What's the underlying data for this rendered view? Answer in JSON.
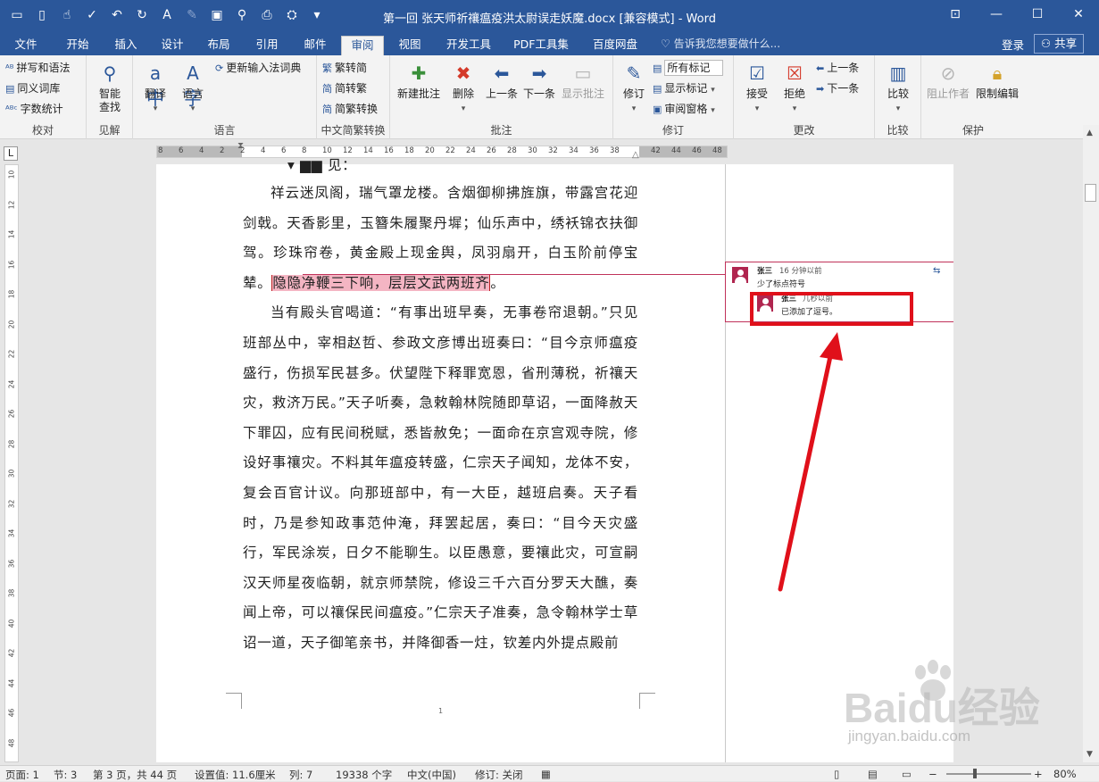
{
  "window": {
    "title": "第一回 张天师祈禳瘟疫洪太尉误走妖魔.docx [兼容模式] - Word",
    "qat": [
      "folder-icon",
      "new-doc-icon",
      "touch-icon",
      "spell-icon",
      "undo-icon",
      "redo-icon",
      "format-painter-icon",
      "print-preview-icon",
      "save-icon",
      "find-icon",
      "preview-icon",
      "share-icon",
      "customize-icon"
    ]
  },
  "tabs": [
    "文件",
    "开始",
    "插入",
    "设计",
    "布局",
    "引用",
    "邮件",
    "审阅",
    "视图",
    "开发工具",
    "PDF工具集",
    "百度网盘"
  ],
  "active_tab": "审阅",
  "tellme": "告诉我您想要做什么...",
  "account": {
    "login": "登录",
    "share": "共享"
  },
  "ribbon": {
    "proofing": {
      "label": "校对",
      "items": [
        "拼写和语法",
        "同义词库",
        "字数统计"
      ]
    },
    "insights": {
      "label": "见解",
      "smart_lookup": "智能\n查找",
      "smart_lookup_1": "智能",
      "smart_lookup_2": "查找"
    },
    "language": {
      "label": "语言",
      "translate": "翻译",
      "language": "语言",
      "ime": "更新输入法词典"
    },
    "chinese": {
      "label": "中文简繁转换",
      "items": [
        "繁转简",
        "简转繁",
        "简繁转换"
      ]
    },
    "comments": {
      "label": "批注",
      "new": "新建批注",
      "delete": "删除",
      "prev": "上一条",
      "next": "下一条",
      "show": "显示批注"
    },
    "tracking": {
      "label": "修订",
      "track": "修订",
      "markup_select": "所有标记",
      "show_markup": "显示标记",
      "pane": "审阅窗格"
    },
    "changes": {
      "label": "更改",
      "accept": "接受",
      "reject": "拒绝",
      "prev": "上一条",
      "next": "下一条"
    },
    "compare": {
      "label": "比较",
      "compare": "比较"
    },
    "protect": {
      "label": "保护",
      "block": "阻止作者",
      "restrict": "限制编辑"
    }
  },
  "ruler": {
    "top": [
      "8",
      "6",
      "4",
      "2",
      "2",
      "4",
      "6",
      "8",
      "10",
      "12",
      "14",
      "16",
      "18",
      "20",
      "22",
      "24",
      "26",
      "28",
      "30",
      "32",
      "34",
      "36",
      "38",
      "42",
      "44",
      "46",
      "48"
    ],
    "left": [
      "10",
      "12",
      "14",
      "16",
      "18",
      "20",
      "22",
      "24",
      "26",
      "28",
      "30",
      "32",
      "34",
      "36",
      "38",
      "40",
      "42",
      "44",
      "46",
      "48"
    ],
    "corner": "L"
  },
  "document": {
    "top_cut": "见：",
    "p1_a": "祥云迷凤阁，瑞气罩龙楼。含烟御柳拂旌旗，带露宫花迎剑戟。天香影里，玉簪朱履聚丹墀；仙乐声中，绣袄锦衣扶御驾。珍珠帘卷，黄金殿上现金舆，凤羽扇开，白玉阶前停宝辇。",
    "p1_highlight": "隐隐净鞭三下响，层层文武两班齐",
    "p1_end": "。",
    "p2": "当有殿头官喝道：“有事出班早奏，无事卷帘退朝。”只见班部丛中，宰相赵哲、参政文彦博出班奏曰：“目今京师瘟疫盛行，伤损军民甚多。伏望陛下释罪宽恩，省刑薄税，祈禳天灾，救济万民。”天子听奏，急敕翰林院随即草诏，一面降赦天下罪囚，应有民间税赋，悉皆赦免；一面命在京宫观寺院，修设好事禳灾。不料其年瘟疫转盛，仁宗天子闻知，龙体不安，复会百官计议。向那班部中，有一大臣，越班启奏。天子看时，乃是参知政事范仲淹，拜罢起居，奏曰：“目今天灾盛行，军民涂炭，日夕不能聊生。以臣愚意，要禳此灾，可宣嗣汉天师星夜临朝，就京师禁院，修设三千六百分罗天大醮，奏闻上帝，可以禳保民间瘟疫。”仁宗天子准奏，急令翰林学士草诏一道，天子御笔亲书，并降御香一炷，钦差内外提点殿前",
    "page_number": "1"
  },
  "comment": {
    "author": "张三",
    "time": "16 分钟以前",
    "text": "少了标点符号",
    "reply_author": "张三",
    "reply_time": "几秒以前",
    "reply_text": "已添加了逗号。"
  },
  "annotation": {
    "box_color": "#e0101a",
    "arrow_color": "#e0101a"
  },
  "statusbar": {
    "page": "页面: 1",
    "section": "节: 3",
    "pages": "第 3 页，共 44 页",
    "position": "设置值: 11.6厘米",
    "column": "列: 7",
    "words": "19338 个字",
    "lang": "中文(中国)",
    "track": "修订: 关闭",
    "zoom": "80%"
  },
  "watermark": {
    "brand": "Baidu经验",
    "url": "jingyan.baidu.com"
  },
  "colors": {
    "accent": "#2b579a",
    "comment": "#c0325a",
    "highlight": "#f4b5c3"
  }
}
